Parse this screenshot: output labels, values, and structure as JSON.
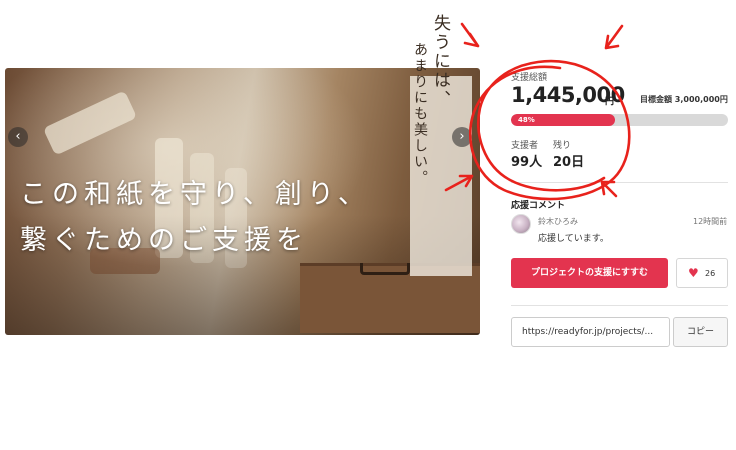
{
  "hero": {
    "vertical_line1": "失うには、",
    "vertical_line2": "あまりにも美しい。",
    "line1": "この和紙を守り、創り、",
    "line2": "繋ぐためのご支援を",
    "prev_icon": "‹",
    "next_icon": "›"
  },
  "funding": {
    "total_label": "支援総額",
    "amount": "1,445,000",
    "unit": "円",
    "goal": "目標金額 3,000,000円",
    "progress_label": "48%",
    "progress_fraction": 0.48,
    "supporters_label": "支援者",
    "supporters_value": "99人",
    "remaining_label": "残り",
    "remaining_value": "20日",
    "accent_color": "#e3344f"
  },
  "comment": {
    "section_title": "応援コメント",
    "author": "鈴木ひろみ",
    "time": "12時間前",
    "body": "応援しています。"
  },
  "actions": {
    "support_label": "プロジェクトの支援にすすむ",
    "like_icon": "heart-icon",
    "like_glyph": "♥",
    "like_count": "26"
  },
  "share": {
    "url": "https://readyfor.jp/projects/...",
    "copy_label": "コピー"
  },
  "annotation": {
    "color": "#e8221c"
  }
}
